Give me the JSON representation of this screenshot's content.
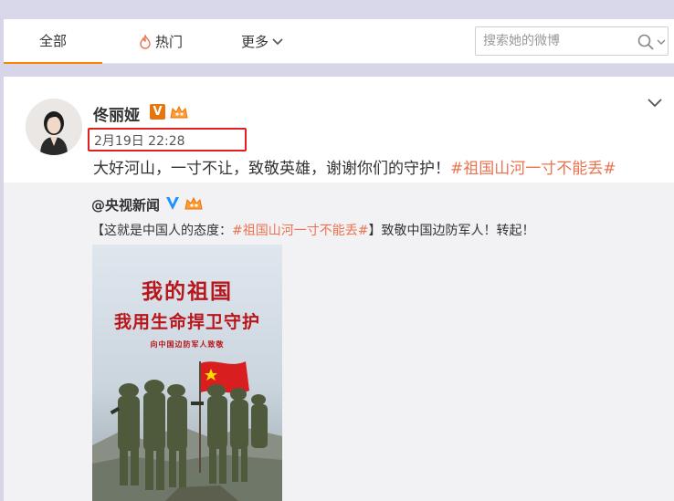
{
  "tabs": {
    "all_label": "全部",
    "hot_label": "热门",
    "more_label": "更多"
  },
  "search": {
    "placeholder": "搜索她的微博"
  },
  "post": {
    "author": "佟丽娅",
    "timestamp": "2月19日 22:28",
    "text": "大好河山，一寸不让，致敬英雄，谢谢你们的守护！",
    "hashtag": "#祖国山河一寸不能丢#"
  },
  "repost": {
    "author": "@央视新闻",
    "text_before": "【这就是中国人的态度：",
    "hashtag": "#祖国山河一寸不能丢#",
    "text_after": "】致敬中国边防军人！转起！",
    "poster": {
      "title_line1": "我的祖国",
      "title_line2": "我用生命捍卫守护",
      "subtitle": "向中国边防军人致敬"
    }
  },
  "colors": {
    "accent": "#ff8200",
    "hashtag": "#eb7350",
    "highlight_box": "#e02020",
    "poster_red": "#b8161b"
  }
}
